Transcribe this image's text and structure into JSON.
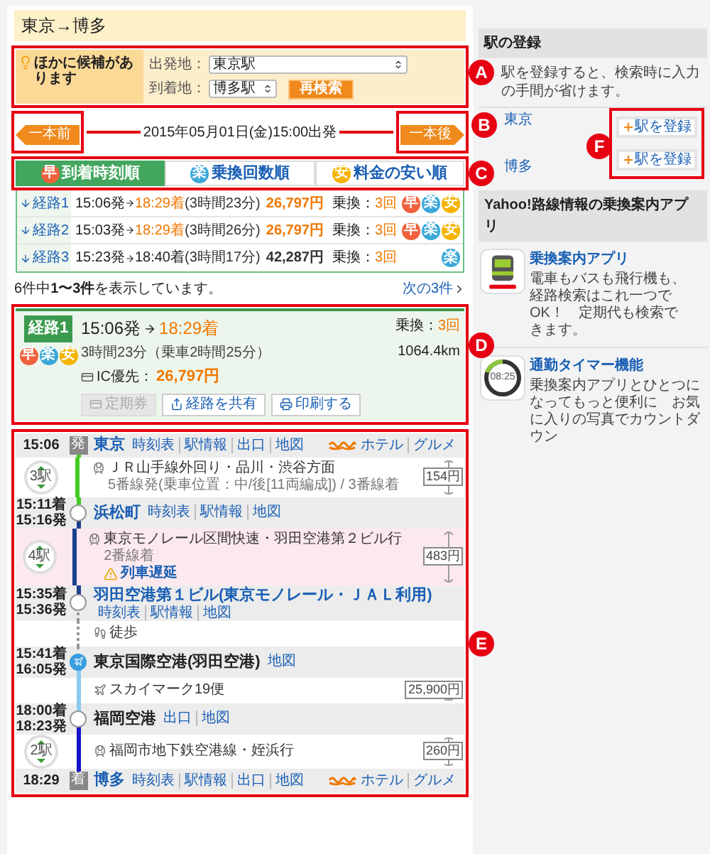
{
  "title": "東京→博多",
  "candidates": {
    "notice": "ほかに候補があります",
    "from_label": "出発地：",
    "from_value": "東京駅",
    "to_label": "到着地：",
    "to_value": "博多駅",
    "research_button": "再検索"
  },
  "nav": {
    "prev": "一本前",
    "date": "2015年05月01日(金)15:00出発",
    "next": "一本後"
  },
  "sort_tabs": [
    {
      "badge": "早",
      "color": "#f0603c",
      "label": "到着時刻順",
      "selected": true
    },
    {
      "badge": "楽",
      "color": "#3aa8d8",
      "label": "乗換回数順",
      "selected": false
    },
    {
      "badge": "安",
      "color": "#f5b400",
      "label": "料金の安い順",
      "selected": false
    }
  ],
  "routes": [
    {
      "name": "経路1",
      "depart": "15:06発",
      "arrive": "18:29着",
      "arrival_best": true,
      "duration": "(3時間23分)",
      "fare": "26,797円",
      "fare_best": true,
      "transfers_label": "乗換：",
      "transfers": "3回",
      "badges": [
        {
          "text": "早",
          "color": "#f0603c"
        },
        {
          "text": "楽",
          "color": "#3aa8d8"
        },
        {
          "text": "安",
          "color": "#f5b400"
        }
      ]
    },
    {
      "name": "経路2",
      "depart": "15:03発",
      "arrive": "18:29着",
      "arrival_best": true,
      "duration": "(3時間26分)",
      "fare": "26,797円",
      "fare_best": true,
      "transfers_label": "乗換：",
      "transfers": "3回",
      "badges": [
        {
          "text": "早",
          "color": "#f0603c"
        },
        {
          "text": "楽",
          "color": "#3aa8d8"
        },
        {
          "text": "安",
          "color": "#f5b400"
        }
      ]
    },
    {
      "name": "経路3",
      "depart": "15:23発",
      "arrive": "18:40着",
      "arrival_best": false,
      "duration": "(3時間17分)",
      "fare": "42,287円",
      "fare_best": false,
      "transfers_label": "乗換：",
      "transfers": "3回",
      "badges": [
        {
          "text": "楽",
          "color": "#3aa8d8"
        }
      ]
    }
  ],
  "result_count": "6件中**1〜3件**を表示しています。",
  "next_page": "次の3件",
  "detail": {
    "route_label": "経路1",
    "badges": [
      {
        "text": "早",
        "color": "#f0603c"
      },
      {
        "text": "楽",
        "color": "#3aa8d8"
      },
      {
        "text": "安",
        "color": "#f5b400"
      }
    ],
    "depart": "15:06発",
    "arrive": "18:29着",
    "duration": "3時間23分（乗車2時間25分）",
    "transfers_label": "乗換：",
    "transfers": "3回",
    "ic_label": "IC優先：",
    "fare": "26,797円",
    "distance": "1064.4km",
    "buttons": [
      {
        "label": "定期券",
        "kind": "pass",
        "disabled": true
      },
      {
        "label": "経路を共有",
        "kind": "share",
        "disabled": false
      },
      {
        "label": "印刷する",
        "kind": "print",
        "disabled": false
      }
    ]
  },
  "timeline": [
    {
      "kind": "stop",
      "times": [
        "15:06"
      ],
      "marker": {
        "kind": "terminal",
        "text": "発"
      },
      "name": "東京",
      "linked": true,
      "links": [
        "時刻表",
        "駅情報",
        "出口",
        "地図"
      ],
      "extras": [
        "ホテル",
        "グルメ"
      ]
    },
    {
      "kind": "segment",
      "icon": {
        "kind": "train"
      },
      "color": "#44cc22",
      "stations": "3駅",
      "title": "ＪＲ山手線外回り・品川・渋谷方面",
      "note": "5番線発(乗車位置：中/後[11両編成]) / 3番線着",
      "fare": "154円",
      "delayed": false
    },
    {
      "kind": "stop",
      "times": [
        "15:11着",
        "15:16発"
      ],
      "marker": {
        "kind": "transfer"
      },
      "name": "浜松町",
      "linked": true,
      "links": [
        "時刻表",
        "駅情報",
        "地図"
      ]
    },
    {
      "kind": "segment",
      "icon": {
        "kind": "train"
      },
      "color": "#1c3f8f",
      "stations": "4駅",
      "title": "東京モノレール区間快速・羽田空港第２ビル行",
      "note": "2番線着",
      "fare": "483円",
      "delayed": true,
      "alert": "列車遅延"
    },
    {
      "kind": "stop",
      "times": [
        "15:35着",
        "15:36発"
      ],
      "marker": {
        "kind": "transfer"
      },
      "name": "羽田空港第１ビル(東京モノレール・ＪＡＬ利用)",
      "linked": true,
      "links": [
        "時刻表",
        "駅情報",
        "地図"
      ]
    },
    {
      "kind": "segment",
      "icon": {
        "kind": "walk"
      },
      "line": {
        "kind": "dotted"
      },
      "color": "#999999",
      "title": "徒歩",
      "delayed": false
    },
    {
      "kind": "stop",
      "times": [
        "15:41着",
        "16:05発"
      ],
      "marker": {
        "kind": "airport"
      },
      "name": "東京国際空港(羽田空港)",
      "linked": false,
      "links": [
        "地図"
      ]
    },
    {
      "kind": "segment",
      "icon": {
        "kind": "plane"
      },
      "color": "#8ccaf0",
      "title": "スカイマーク19便",
      "fare": "25,900円",
      "delayed": false
    },
    {
      "kind": "stop",
      "times": [
        "18:00着",
        "18:23発"
      ],
      "marker": {
        "kind": "transfer"
      },
      "name": "福岡空港",
      "linked": false,
      "links": [
        "出口",
        "地図"
      ]
    },
    {
      "kind": "segment",
      "icon": {
        "kind": "train"
      },
      "color": "#1414c8",
      "stations": "2駅",
      "title": "福岡市地下鉄空港線・姪浜行",
      "fare": "260円",
      "delayed": false
    },
    {
      "kind": "stop",
      "times": [
        "18:29"
      ],
      "marker": {
        "kind": "terminal",
        "text": "着"
      },
      "name": "博多",
      "linked": true,
      "links": [
        "時刻表",
        "駅情報",
        "出口",
        "地図"
      ],
      "extras": [
        "ホテル",
        "グルメ"
      ]
    }
  ],
  "sidebar": {
    "register_heading": "駅の登録",
    "register_description": "駅を登録すると、検索時に入力の手間が省けます。",
    "stations": [
      {
        "name": "東京",
        "button": "駅を登録"
      },
      {
        "name": "博多",
        "button": "駅を登録"
      }
    ],
    "apps_heading": "Yahoo!路線情報の乗換案内アプリ",
    "apps": [
      {
        "kind": "train",
        "title": "乗換案内アプリ",
        "description": "電車もバスも飛行機も、経路検索はこれ一つでOK！　定期代も検索できます。"
      },
      {
        "kind": "timer",
        "icon_text": "08:25",
        "title": "通勤タイマー機能",
        "description": "乗換案内アプリとひとつになってもっと便利に　お気に入りの写真でカウントダウン"
      }
    ]
  },
  "annotations": [
    "A",
    "B",
    "C",
    "D",
    "E",
    "F"
  ]
}
